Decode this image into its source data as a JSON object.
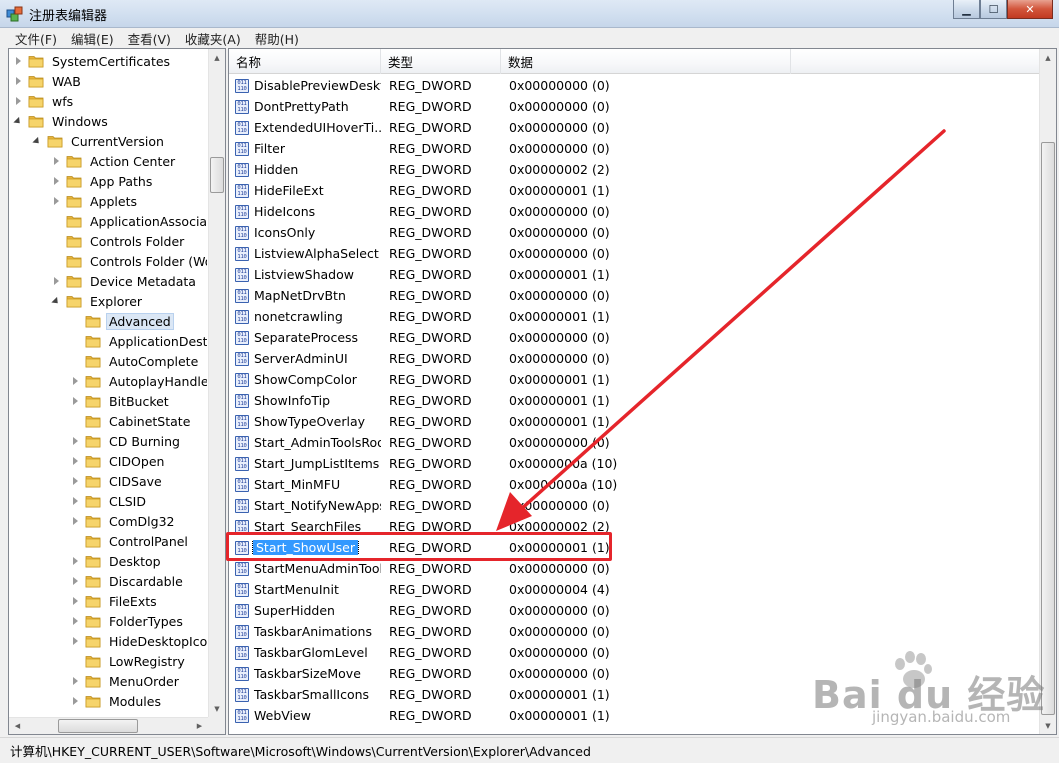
{
  "window": {
    "title": "注册表编辑器",
    "controls": {
      "minimize": "▁",
      "maximize": "☐",
      "close": "✕"
    }
  },
  "menu": [
    "文件(F)",
    "编辑(E)",
    "查看(V)",
    "收藏夹(A)",
    "帮助(H)"
  ],
  "tree": {
    "items": [
      {
        "label": "SystemCertificates",
        "level": 0,
        "expander": "collapsed"
      },
      {
        "label": "WAB",
        "level": 0,
        "expander": "collapsed"
      },
      {
        "label": "wfs",
        "level": 0,
        "expander": "collapsed"
      },
      {
        "label": "Windows",
        "level": 0,
        "expander": "expanded"
      },
      {
        "label": "CurrentVersion",
        "level": 1,
        "expander": "expanded"
      },
      {
        "label": "Action Center",
        "level": 2,
        "expander": "collapsed"
      },
      {
        "label": "App Paths",
        "level": 2,
        "expander": "collapsed"
      },
      {
        "label": "Applets",
        "level": 2,
        "expander": "collapsed"
      },
      {
        "label": "ApplicationAssociati",
        "level": 2,
        "expander": "none"
      },
      {
        "label": "Controls Folder",
        "level": 2,
        "expander": "none"
      },
      {
        "label": "Controls Folder (Wo",
        "level": 2,
        "expander": "none"
      },
      {
        "label": "Device Metadata",
        "level": 2,
        "expander": "collapsed"
      },
      {
        "label": "Explorer",
        "level": 2,
        "expander": "expanded"
      },
      {
        "label": "Advanced",
        "level": 3,
        "expander": "none",
        "selected": true
      },
      {
        "label": "ApplicationDestir",
        "level": 3,
        "expander": "none"
      },
      {
        "label": "AutoComplete",
        "level": 3,
        "expander": "none"
      },
      {
        "label": "AutoplayHandlers",
        "level": 3,
        "expander": "collapsed"
      },
      {
        "label": "BitBucket",
        "level": 3,
        "expander": "collapsed"
      },
      {
        "label": "CabinetState",
        "level": 3,
        "expander": "none"
      },
      {
        "label": "CD Burning",
        "level": 3,
        "expander": "collapsed"
      },
      {
        "label": "CIDOpen",
        "level": 3,
        "expander": "collapsed"
      },
      {
        "label": "CIDSave",
        "level": 3,
        "expander": "collapsed"
      },
      {
        "label": "CLSID",
        "level": 3,
        "expander": "collapsed"
      },
      {
        "label": "ComDlg32",
        "level": 3,
        "expander": "collapsed"
      },
      {
        "label": "ControlPanel",
        "level": 3,
        "expander": "none"
      },
      {
        "label": "Desktop",
        "level": 3,
        "expander": "collapsed"
      },
      {
        "label": "Discardable",
        "level": 3,
        "expander": "collapsed"
      },
      {
        "label": "FileExts",
        "level": 3,
        "expander": "collapsed"
      },
      {
        "label": "FolderTypes",
        "level": 3,
        "expander": "collapsed"
      },
      {
        "label": "HideDesktopIcor",
        "level": 3,
        "expander": "collapsed"
      },
      {
        "label": "LowRegistry",
        "level": 3,
        "expander": "none"
      },
      {
        "label": "MenuOrder",
        "level": 3,
        "expander": "collapsed"
      },
      {
        "label": "Modules",
        "level": 3,
        "expander": "collapsed"
      }
    ]
  },
  "list": {
    "columns": [
      "名称",
      "类型",
      "数据"
    ],
    "rows": [
      {
        "name": "DisablePreviewDeskt...",
        "type": "REG_DWORD",
        "data": "0x00000000 (0)"
      },
      {
        "name": "DontPrettyPath",
        "type": "REG_DWORD",
        "data": "0x00000000 (0)"
      },
      {
        "name": "ExtendedUIHoverTi...",
        "type": "REG_DWORD",
        "data": "0x00000000 (0)"
      },
      {
        "name": "Filter",
        "type": "REG_DWORD",
        "data": "0x00000000 (0)"
      },
      {
        "name": "Hidden",
        "type": "REG_DWORD",
        "data": "0x00000002 (2)"
      },
      {
        "name": "HideFileExt",
        "type": "REG_DWORD",
        "data": "0x00000001 (1)"
      },
      {
        "name": "HideIcons",
        "type": "REG_DWORD",
        "data": "0x00000000 (0)"
      },
      {
        "name": "IconsOnly",
        "type": "REG_DWORD",
        "data": "0x00000000 (0)"
      },
      {
        "name": "ListviewAlphaSelect",
        "type": "REG_DWORD",
        "data": "0x00000000 (0)"
      },
      {
        "name": "ListviewShadow",
        "type": "REG_DWORD",
        "data": "0x00000001 (1)"
      },
      {
        "name": "MapNetDrvBtn",
        "type": "REG_DWORD",
        "data": "0x00000000 (0)"
      },
      {
        "name": "nonetcrawling",
        "type": "REG_DWORD",
        "data": "0x00000001 (1)"
      },
      {
        "name": "SeparateProcess",
        "type": "REG_DWORD",
        "data": "0x00000000 (0)"
      },
      {
        "name": "ServerAdminUI",
        "type": "REG_DWORD",
        "data": "0x00000000 (0)"
      },
      {
        "name": "ShowCompColor",
        "type": "REG_DWORD",
        "data": "0x00000001 (1)"
      },
      {
        "name": "ShowInfoTip",
        "type": "REG_DWORD",
        "data": "0x00000001 (1)"
      },
      {
        "name": "ShowTypeOverlay",
        "type": "REG_DWORD",
        "data": "0x00000001 (1)"
      },
      {
        "name": "Start_AdminToolsRoot",
        "type": "REG_DWORD",
        "data": "0x00000000 (0)"
      },
      {
        "name": "Start_JumpListItems",
        "type": "REG_DWORD",
        "data": "0x0000000a (10)"
      },
      {
        "name": "Start_MinMFU",
        "type": "REG_DWORD",
        "data": "0x0000000a (10)"
      },
      {
        "name": "Start_NotifyNewApps",
        "type": "REG_DWORD",
        "data": "0x00000000 (0)"
      },
      {
        "name": "Start_SearchFiles",
        "type": "REG_DWORD",
        "data": "0x00000002 (2)"
      },
      {
        "name": "Start_ShowUser",
        "type": "REG_DWORD",
        "data": "0x00000001 (1)",
        "selected": true
      },
      {
        "name": "StartMenuAdminTools",
        "type": "REG_DWORD",
        "data": "0x00000000 (0)"
      },
      {
        "name": "StartMenuInit",
        "type": "REG_DWORD",
        "data": "0x00000004 (4)"
      },
      {
        "name": "SuperHidden",
        "type": "REG_DWORD",
        "data": "0x00000000 (0)"
      },
      {
        "name": "TaskbarAnimations",
        "type": "REG_DWORD",
        "data": "0x00000000 (0)"
      },
      {
        "name": "TaskbarGlomLevel",
        "type": "REG_DWORD",
        "data": "0x00000000 (0)"
      },
      {
        "name": "TaskbarSizeMove",
        "type": "REG_DWORD",
        "data": "0x00000000 (0)"
      },
      {
        "name": "TaskbarSmallIcons",
        "type": "REG_DWORD",
        "data": "0x00000001 (1)"
      },
      {
        "name": "WebView",
        "type": "REG_DWORD",
        "data": "0x00000001 (1)"
      }
    ]
  },
  "status": {
    "path": "计算机\\HKEY_CURRENT_USER\\Software\\Microsoft\\Windows\\CurrentVersion\\Explorer\\Advanced"
  },
  "annotation": {
    "color": "#e5252b"
  },
  "watermark": {
    "logo": "Bai du 经验",
    "sub": "jingyan.baidu.com"
  },
  "colors": {
    "selection": "#3399ff",
    "folder": "#f2c94c",
    "folder_dark": "#d7a52a"
  }
}
